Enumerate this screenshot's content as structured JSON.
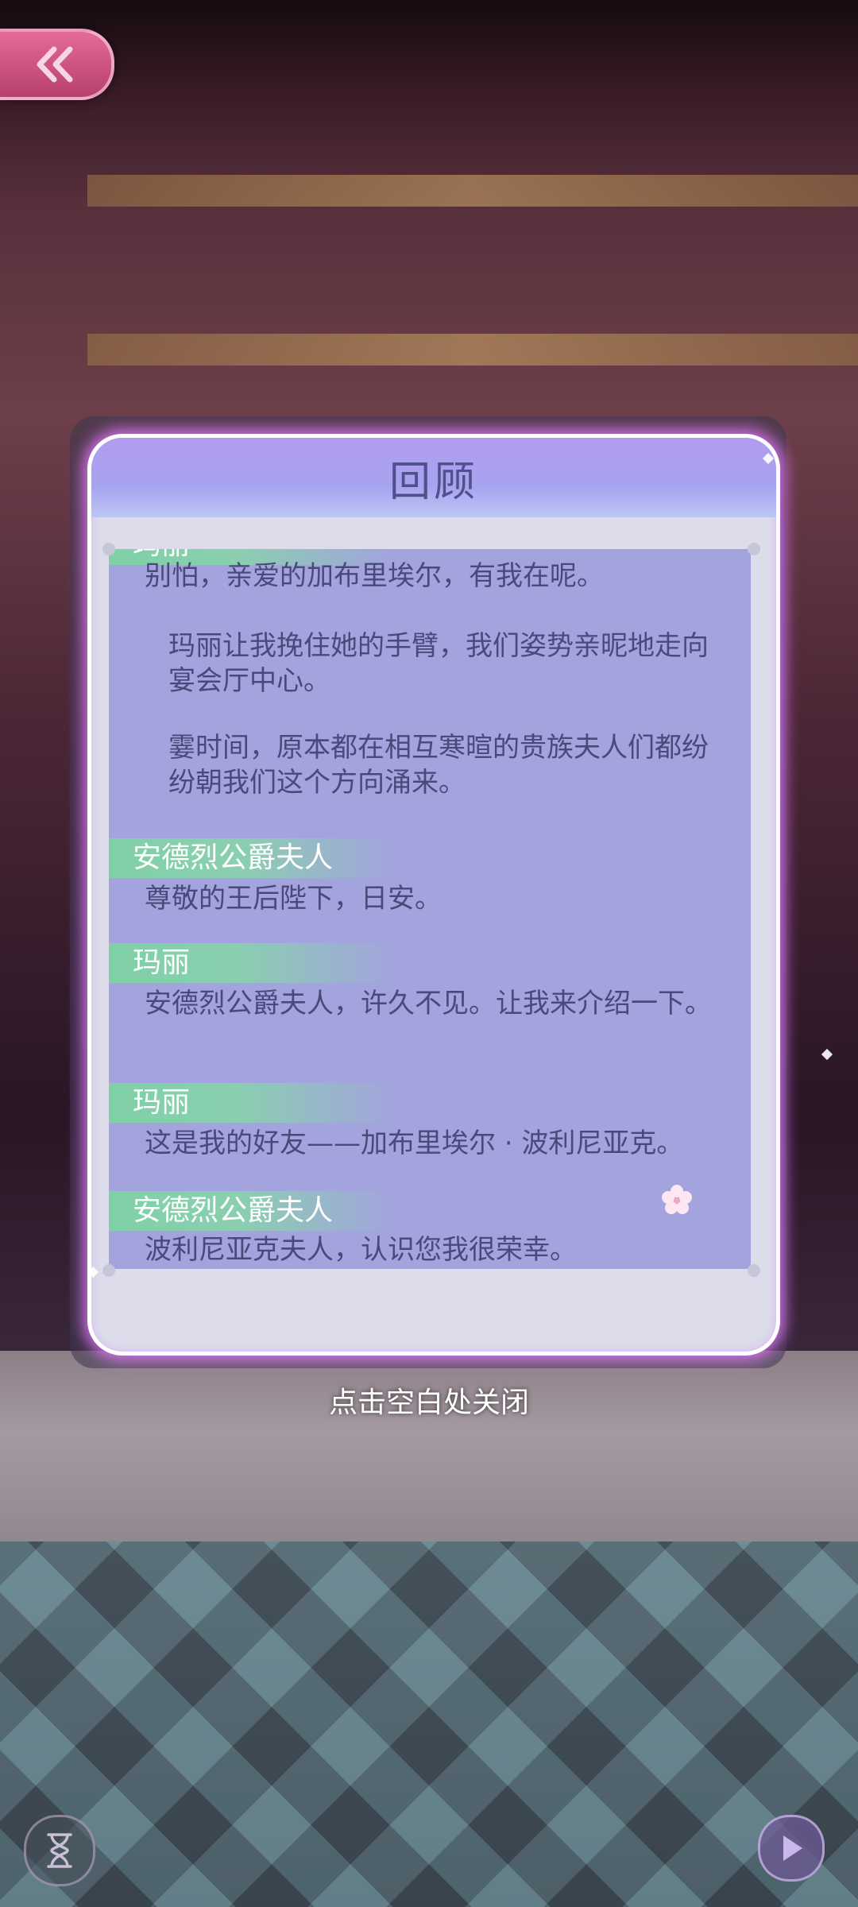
{
  "dialog": {
    "title": "回顾",
    "close_hint": "点击空白处关闭",
    "partial_speaker": "玛丽",
    "entries": [
      {
        "line": "别怕，亲爱的加布里埃尔，有我在呢。"
      },
      {
        "narration": "玛丽让我挽住她的手臂，我们姿势亲昵地走向宴会厅中心。"
      },
      {
        "narration": "霎时间，原本都在相互寒暄的贵族夫人们都纷纷朝我们这个方向涌来。"
      },
      {
        "speaker": "安德烈公爵夫人",
        "line": "尊敬的王后陛下，日安。"
      },
      {
        "speaker": "玛丽",
        "line": "安德烈公爵夫人，许久不见。让我来介绍一下。"
      },
      {
        "speaker": "玛丽",
        "line": "这是我的好友——加布里埃尔 · 波利尼亚克。"
      },
      {
        "speaker": "安德烈公爵夫人",
        "line": "波利尼亚克夫人，认识您我很荣幸。"
      }
    ]
  },
  "icons": {
    "back": "double-chevron-left-icon",
    "hourglass": "hourglass-icon",
    "play": "play-icon",
    "flower": "flower-icon"
  },
  "colors": {
    "speaker_tag": "#7fd0a6",
    "panel_glow": "#e678ff",
    "back_button": "#d9578a",
    "text": "#4a4a7a"
  }
}
